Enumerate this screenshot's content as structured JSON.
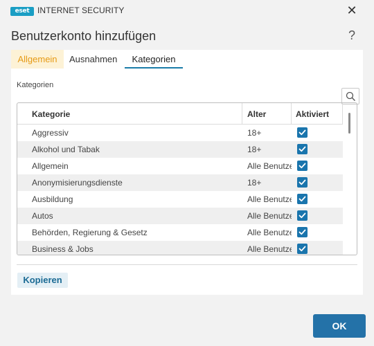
{
  "window": {
    "logo_text": "eset",
    "product_name": "INTERNET SECURITY",
    "close_glyph": "✕"
  },
  "dialog": {
    "title": "Benutzerkonto hinzufügen",
    "help_glyph": "?"
  },
  "tabs": [
    {
      "label": "Allgemein",
      "state": "highlighted"
    },
    {
      "label": "Ausnahmen",
      "state": "normal"
    },
    {
      "label": "Kategorien",
      "state": "active"
    }
  ],
  "section_label": "Kategorien",
  "table": {
    "columns": [
      "Kategorie",
      "Alter",
      "Aktiviert"
    ],
    "rows": [
      {
        "category": "Aggressiv",
        "age": "18+",
        "enabled": true
      },
      {
        "category": "Alkohol und Tabak",
        "age": "18+",
        "enabled": true
      },
      {
        "category": "Allgemein",
        "age": "Alle Benutzer",
        "enabled": true
      },
      {
        "category": "Anonymisierungsdienste",
        "age": "18+",
        "enabled": true
      },
      {
        "category": "Ausbildung",
        "age": "Alle Benutzer",
        "enabled": true
      },
      {
        "category": "Autos",
        "age": "Alle Benutzer",
        "enabled": true
      },
      {
        "category": "Behörden, Regierung & Gesetz",
        "age": "Alle Benutzer",
        "enabled": true
      },
      {
        "category": "Business & Jobs",
        "age": "Alle Benutzer",
        "enabled": true
      }
    ]
  },
  "buttons": {
    "copy": "Kopieren",
    "ok": "OK"
  },
  "icons": {
    "search": "search-icon",
    "checkbox": "checkmark-icon",
    "close": "close-icon",
    "help": "help-icon"
  },
  "colors": {
    "accent_blue": "#2472a8",
    "checkbox_blue": "#1a75ad",
    "tab_highlight_bg": "#fdf2d6",
    "tab_highlight_text": "#e69a14",
    "logo_blue": "#1a9ec4"
  }
}
